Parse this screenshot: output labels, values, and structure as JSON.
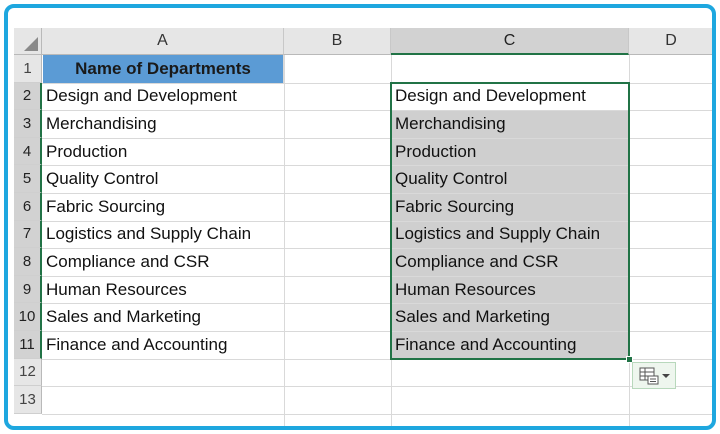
{
  "columns": [
    "A",
    "B",
    "C",
    "D"
  ],
  "rows": [
    "1",
    "2",
    "3",
    "4",
    "5",
    "6",
    "7",
    "8",
    "9",
    "10",
    "11",
    "12",
    "13"
  ],
  "column_a": {
    "header": "Name of Departments",
    "items": [
      "Design and Development",
      "Merchandising",
      "Production",
      "Quality Control",
      "Fabric Sourcing",
      "Logistics and Supply Chain",
      "Compliance and CSR",
      "Human Resources",
      "Sales and Marketing",
      "Finance and Accounting"
    ]
  },
  "column_c": {
    "items": [
      "Design and Development",
      "Merchandising",
      "Production",
      "Quality Control",
      "Fabric Sourcing",
      "Logistics and Supply Chain",
      "Compliance and CSR",
      "Human Resources",
      "Sales and Marketing",
      "Finance and Accounting"
    ]
  },
  "selection": {
    "column": "C",
    "from_row": 2,
    "to_row": 11
  },
  "icons": {
    "paste_options": "paste-options-icon",
    "dropdown": "chevron-down-icon",
    "select_all": "select-all-triangle-icon"
  },
  "colors": {
    "header_fill": "#5b9bd5",
    "selection_border": "#217346",
    "selection_fill": "#cfcfcf",
    "frame": "#1ea7df"
  }
}
